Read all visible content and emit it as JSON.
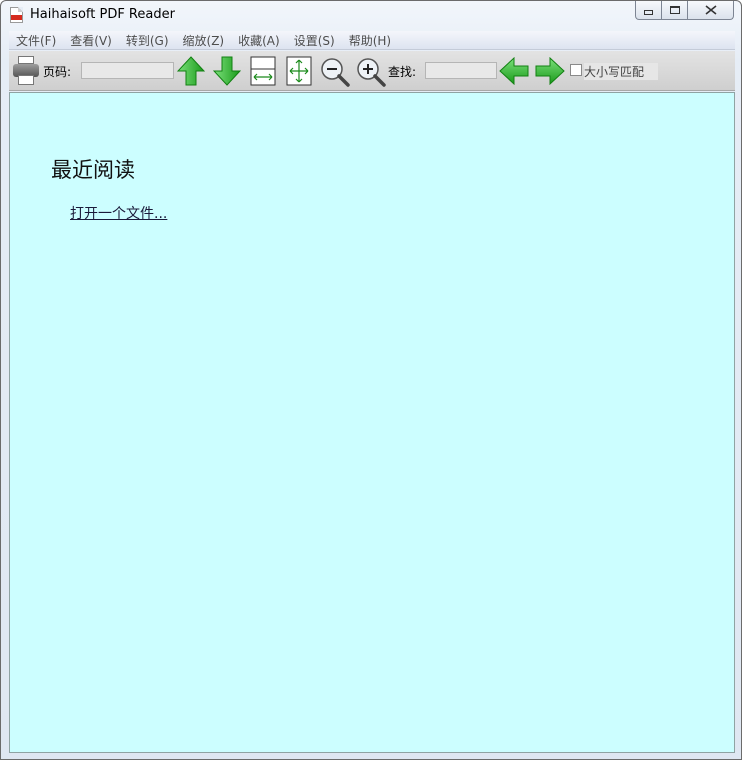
{
  "window": {
    "title": "Haihaisoft PDF Reader"
  },
  "menu": {
    "items": [
      {
        "label": "文件(F)"
      },
      {
        "label": "查看(V)"
      },
      {
        "label": "转到(G)"
      },
      {
        "label": "缩放(Z)"
      },
      {
        "label": "收藏(A)"
      },
      {
        "label": "设置(S)"
      },
      {
        "label": "帮助(H)"
      }
    ]
  },
  "toolbar": {
    "page_label": "页码:",
    "page_value": "",
    "search_label": "查找:",
    "search_value": "",
    "match_case_label": "大小写匹配",
    "match_case_checked": false,
    "icons": [
      "printer-icon",
      "arrow-up-icon",
      "arrow-down-icon",
      "fit-width-icon",
      "fit-page-icon",
      "zoom-out-icon",
      "zoom-in-icon",
      "arrow-left-icon",
      "arrow-right-icon"
    ]
  },
  "content": {
    "recent_heading": "最近阅读",
    "open_file_link": "打开一个文件..."
  },
  "colors": {
    "content_bg": "#ccfeff",
    "arrow_green": "#22b022"
  }
}
